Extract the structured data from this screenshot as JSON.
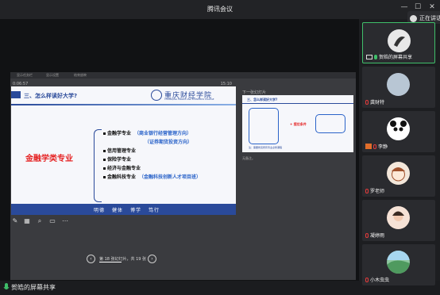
{
  "window": {
    "title": "腾讯会议",
    "min": "—",
    "max": "☐",
    "close": "✕",
    "speaking": "正在讲话："
  },
  "ppt": {
    "toolbar": [
      "显示任务栏",
      "显示设置",
      "结束放映"
    ],
    "timer": "0:06:57",
    "clock": "15:10",
    "slide": {
      "title": "三、怎么样读好大学?",
      "logo_name": "重庆财经学院",
      "logo_en": "CHONGQING FINANCE AND ECONOMICS COLLEGE",
      "major": "金融学类专业",
      "items": [
        {
          "label": "金融学专业",
          "note": "（商业银行经营管理方向）"
        },
        {
          "label": "",
          "note": "（证券期货投资方向）"
        },
        {
          "label": "信用管理专业",
          "note": ""
        },
        {
          "label": "保险学专业",
          "note": ""
        },
        {
          "label": "经济与金融专业",
          "note": ""
        },
        {
          "label": "金融科技专业",
          "note": "（金融科技创新人才项目班）"
        }
      ],
      "footer": [
        "明德",
        "健体",
        "博学",
        "笃行"
      ]
    },
    "next_label": "下一张幻灯片",
    "next": {
      "title": "三、怎么样读好大学?",
      "condition": "+ 提位条件",
      "footer": "注：需要修完所有专业必修课程"
    },
    "notes": "无备注。",
    "nav": {
      "text": "第 18 张幻灯片，共 19 张",
      "prev": "‹",
      "next": "›"
    }
  },
  "bottom": {
    "label": "贺皓的屏幕共享"
  },
  "participants": [
    {
      "name": "贺皓的屏幕共享",
      "mic": "green",
      "share": true
    },
    {
      "name": "龚财特",
      "mic": "red"
    },
    {
      "name": "李静",
      "mic": "red",
      "cam": true
    },
    {
      "name": "罗老师",
      "mic": "red"
    },
    {
      "name": "凝婷雨",
      "mic": "red"
    },
    {
      "name": "小木虫虫",
      "mic": "red"
    }
  ]
}
